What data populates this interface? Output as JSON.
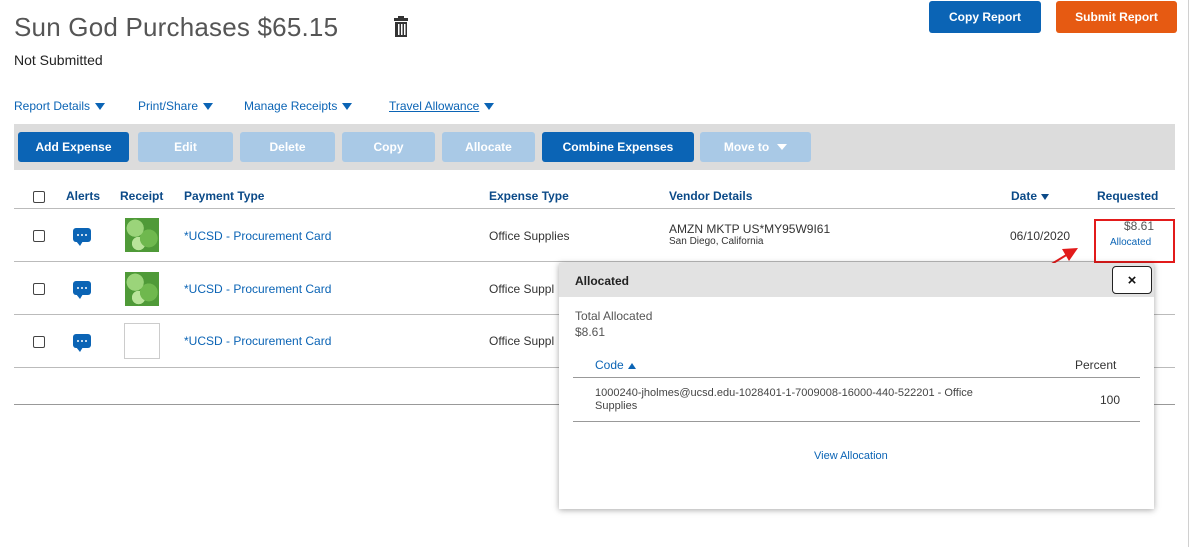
{
  "report": {
    "title": "Sun God Purchases $65.15",
    "status": "Not Submitted",
    "copy_label": "Copy Report",
    "submit_label": "Submit Report"
  },
  "menus": [
    {
      "label": "Report Details"
    },
    {
      "label": "Print/Share"
    },
    {
      "label": "Manage Receipts"
    },
    {
      "label": "Travel Allowance"
    }
  ],
  "toolbar": {
    "add": "Add Expense",
    "edit": "Edit",
    "delete": "Delete",
    "copy": "Copy",
    "allocate": "Allocate",
    "combine": "Combine Expenses",
    "move": "Move to"
  },
  "columns": {
    "alerts": "Alerts",
    "receipt": "Receipt",
    "payment": "Payment Type",
    "expense": "Expense Type",
    "vendor": "Vendor Details",
    "date": "Date",
    "requested": "Requested"
  },
  "rows": [
    {
      "payment": "*UCSD - Procurement Card",
      "expense": "Office Supplies",
      "vendor": "AMZN MKTP US*MY95W9I61",
      "location": "San Diego, California",
      "date": "06/10/2020",
      "amount": "$8.61",
      "allocation": "Allocated"
    },
    {
      "payment": "*UCSD - Procurement Card",
      "expense": "Office Suppl"
    },
    {
      "payment": "*UCSD - Procurement Card",
      "expense": "Office Suppl"
    }
  ],
  "popup": {
    "title": "Allocated",
    "close": "×",
    "total_label": "Total Allocated",
    "total_value": "$8.61",
    "code_header": "Code",
    "percent_header": "Percent",
    "code_line1": "1000240-jholmes@ucsd.edu-1028401-1-7009008-16000-440-522201 - Office",
    "code_line2": "Supplies",
    "percent": "100",
    "view_link": "View Allocation"
  },
  "colors": {
    "primary": "#0b64b5",
    "disabled": "#a9c9e6",
    "submit": "#e65a12",
    "highlight": "#e21b1b"
  }
}
